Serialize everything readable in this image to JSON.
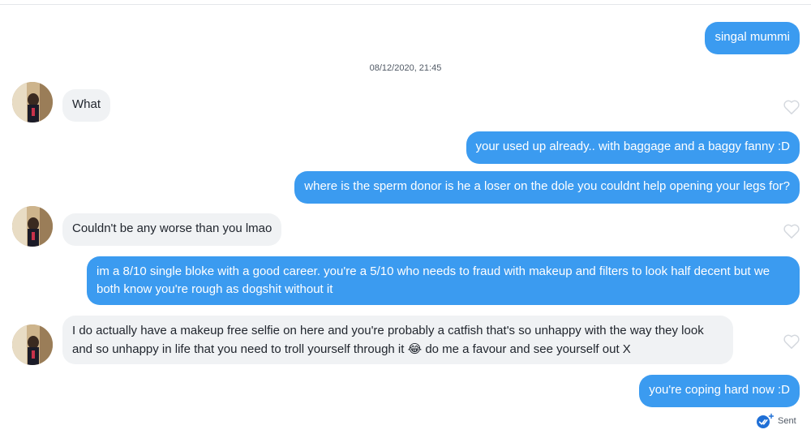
{
  "messages": [
    {
      "from": "me",
      "text": "singal mummi"
    },
    {
      "from": "them",
      "text": "What"
    },
    {
      "from": "me",
      "text": "your used up already.. with baggage and a baggy fanny :D"
    },
    {
      "from": "me",
      "text": "where is the sperm donor is he a loser on the dole you couldnt help opening your legs for?"
    },
    {
      "from": "them",
      "text": "Couldn't be any worse than you lmao"
    },
    {
      "from": "me",
      "text": "im a 8/10 single bloke with a good career. you're a 5/10 who needs to fraud with makeup and filters to look half decent but we both know you're rough as dogshit without it"
    },
    {
      "from": "them",
      "text_before": "I do actually have a makeup free selfie on here and you're probably a catfish that's so unhappy with the way they look and so unhappy in life that you need to troll yourself through it",
      "emoji": "😂",
      "text_after": "do me a favour and see yourself out X"
    },
    {
      "from": "me",
      "text": "you're coping hard now :D"
    }
  ],
  "timestamp": "08/12/2020, 21:45",
  "status": {
    "label": "Sent",
    "icon": "double-check-icon"
  },
  "icons": {
    "like": "heart-outline-icon",
    "avatar": "profile-photo"
  },
  "colors": {
    "outgoing": "#3b9bf0",
    "incoming": "#f0f2f4",
    "status_check": "#1f6fd6"
  }
}
